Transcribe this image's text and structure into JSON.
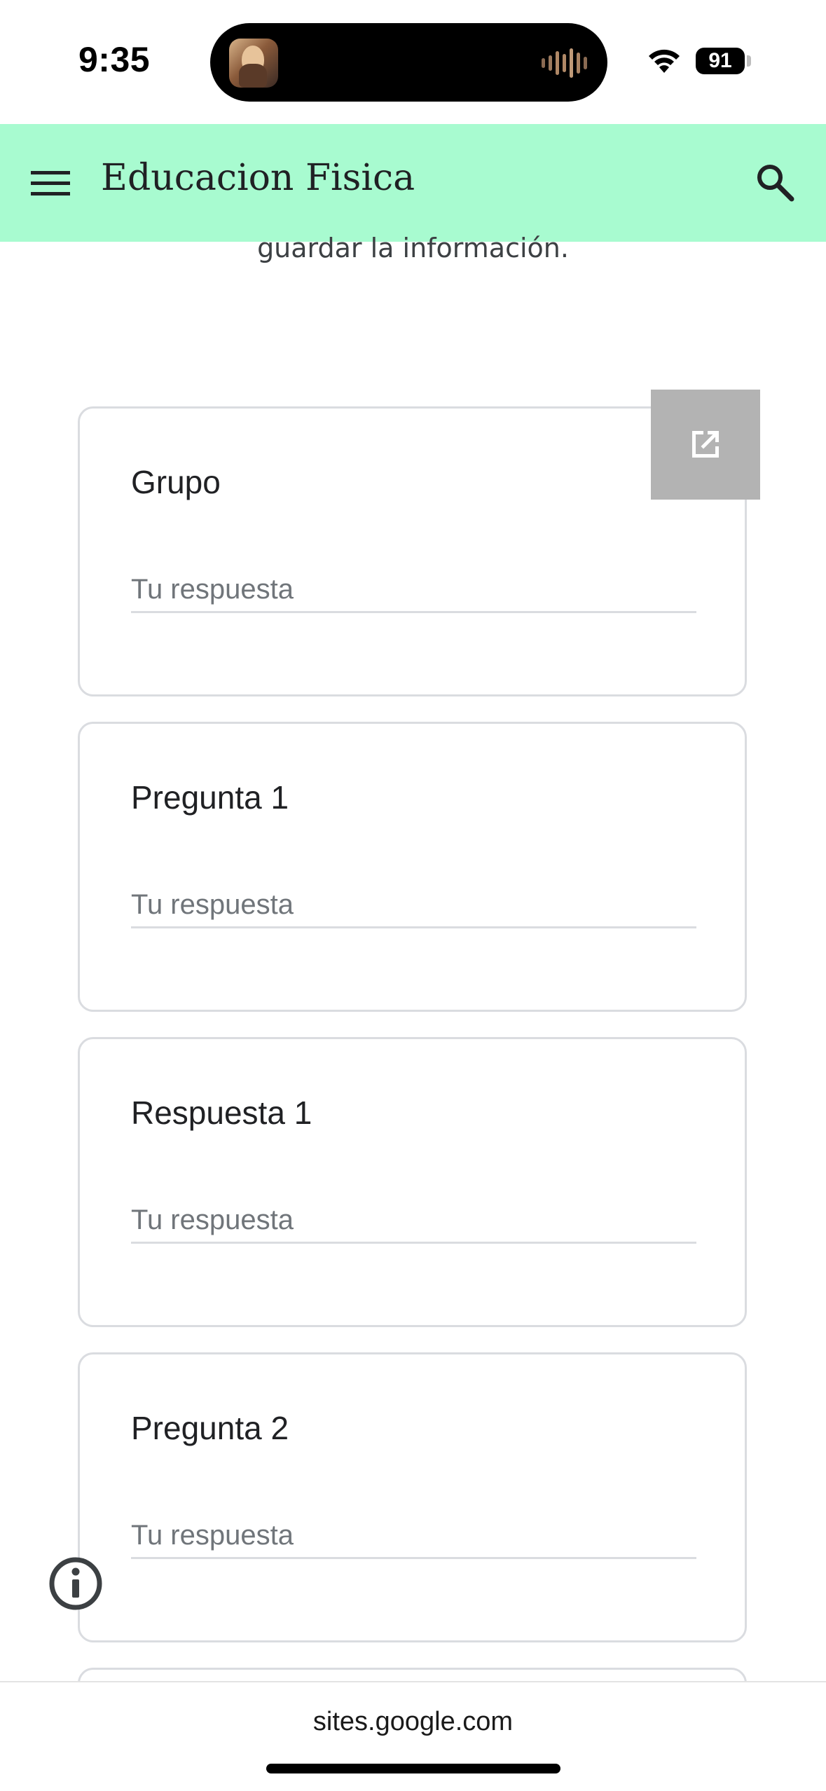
{
  "status_bar": {
    "time": "9:35",
    "battery": "91",
    "icons": [
      "wifi-icon",
      "battery-icon",
      "audio-wave-icon"
    ]
  },
  "header": {
    "title": "Educacion Fisica",
    "menu_icon": "menu-icon",
    "search_icon": "search-icon",
    "background": "#a8fbd0"
  },
  "intro_text_fragment": "guardar la información.",
  "form": {
    "questions": [
      {
        "title": "Grupo",
        "placeholder": "Tu respuesta"
      },
      {
        "title": "Pregunta 1",
        "placeholder": "Tu respuesta"
      },
      {
        "title": "Respuesta 1",
        "placeholder": "Tu respuesta"
      },
      {
        "title": "Pregunta 2",
        "placeholder": "Tu respuesta"
      }
    ],
    "popout_icon": "open-in-new-icon"
  },
  "info_icon": "info-icon",
  "browser": {
    "url": "sites.google.com"
  }
}
